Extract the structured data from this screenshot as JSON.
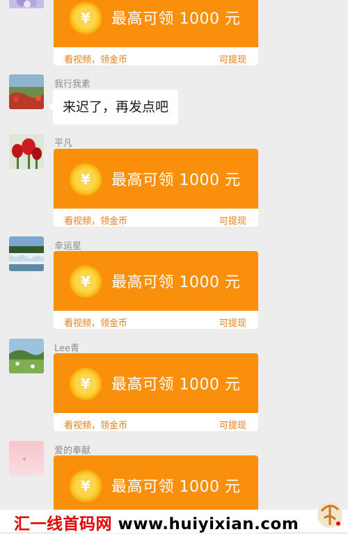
{
  "card": {
    "title": "最高可领 1000 元",
    "coin_symbol": "¥",
    "coin_icon": "yuan-coin-icon",
    "footer_left": "看视频，领金币",
    "footer_right": "可提现",
    "colors": {
      "orange": "#fa8f0c",
      "coin": "#fdc928",
      "footer_text": "#ea7d17"
    }
  },
  "messages": [
    {
      "sender": "",
      "avatar": "lavender-flowers-avatar",
      "type": "card"
    },
    {
      "sender": "我行我素",
      "avatar": "red-flowers-landscape-avatar",
      "type": "text",
      "text": "来迟了，再发点吧"
    },
    {
      "sender": "平凡",
      "avatar": "red-tulips-avatar",
      "type": "card"
    },
    {
      "sender": "幸运星",
      "avatar": "waterfall-avatar",
      "type": "card"
    },
    {
      "sender": "Lee青",
      "avatar": "green-meadow-avatar",
      "type": "card"
    },
    {
      "sender": "爱的奉献",
      "avatar": "pink-gradient-avatar",
      "type": "card"
    }
  ],
  "watermark": {
    "site_name": "汇一线首码网",
    "url": "www.huiyixian.com",
    "logo": "site-logo-icon"
  }
}
